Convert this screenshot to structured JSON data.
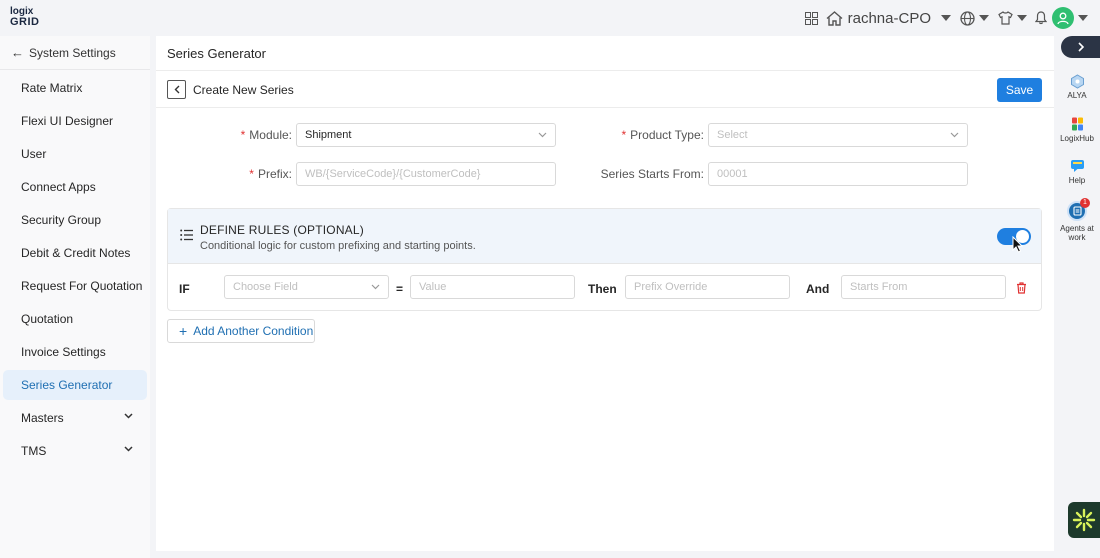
{
  "header": {
    "logo_line1": "logix",
    "logo_line2": "GRID",
    "user_name": "rachna-CPO"
  },
  "sidebar": {
    "back_label": "System Settings",
    "items": [
      {
        "label": "Rate Matrix"
      },
      {
        "label": "Flexi UI Designer"
      },
      {
        "label": "User"
      },
      {
        "label": "Connect Apps"
      },
      {
        "label": "Security Group"
      },
      {
        "label": "Debit & Credit Notes"
      },
      {
        "label": "Request For Quotation"
      },
      {
        "label": "Quotation"
      },
      {
        "label": "Invoice Settings"
      },
      {
        "label": "Series Generator",
        "active": true
      },
      {
        "label": "Masters",
        "expandable": true
      },
      {
        "label": "TMS",
        "expandable": true
      }
    ]
  },
  "page": {
    "title": "Series Generator",
    "subtitle": "Create New Series",
    "save_label": "Save"
  },
  "form": {
    "module_label": "Module",
    "module_value": "Shipment",
    "product_type_label": "Product Type",
    "product_type_placeholder": "Select",
    "prefix_label": "Prefix",
    "prefix_placeholder": "WB/{ServiceCode}/{CustomerCode}",
    "starts_from_label": "Series Starts From",
    "starts_from_placeholder": "00001",
    "label_suffix": ":"
  },
  "rules": {
    "title": "DEFINE RULES (OPTIONAL)",
    "description": "Conditional logic for custom prefixing and starting points.",
    "toggle_on": true,
    "if_label": "IF",
    "field_placeholder": "Choose Field",
    "equals": "=",
    "value_placeholder": "Value",
    "then_label": "Then",
    "prefix_override_placeholder": "Prefix Override",
    "and_label": "And",
    "starts_from_placeholder": "Starts From",
    "add_condition_label": "Add Another Condition"
  },
  "rail": {
    "items": [
      {
        "label": "ALYA"
      },
      {
        "label": "LogixHub"
      },
      {
        "label": "Help"
      },
      {
        "label": "Agents at work",
        "badge": "1"
      }
    ]
  },
  "colors": {
    "primary": "#1f7fe0",
    "required": "#e03131",
    "active_bg": "#e6f0fb",
    "rules_bg": "#f0f5fb",
    "avatar": "#2fbf71"
  }
}
